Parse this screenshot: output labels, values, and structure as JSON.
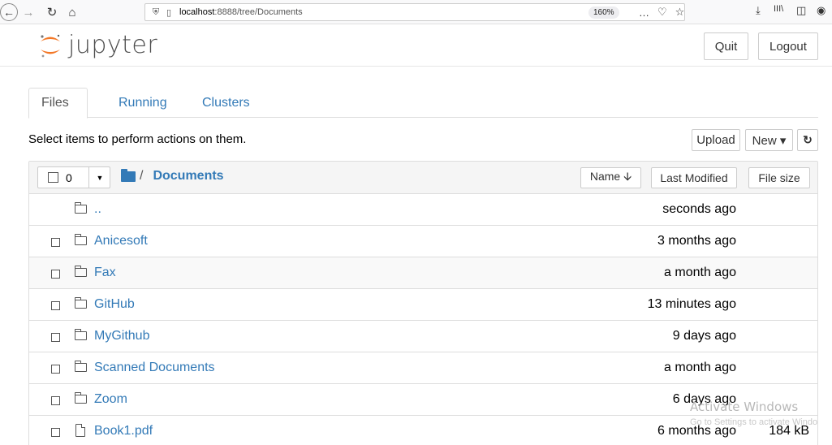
{
  "browser": {
    "back_icon": "←",
    "forward_icon": "→",
    "reload_icon": "↻",
    "home_icon": "⌂",
    "url_prefix": "localhost",
    "url_rest": ":8888/tree/Documents",
    "zoom": "160%",
    "more_icon": "…",
    "pocket_icon": "♡",
    "star_icon": "☆",
    "download_icon": "⤓",
    "library_icon": "III\\",
    "sidebar_icon": "◫",
    "account_icon": "◉"
  },
  "header": {
    "logo_text": "jupyter",
    "quit_label": "Quit",
    "logout_label": "Logout"
  },
  "tabs": [
    {
      "label": "Files"
    },
    {
      "label": "Running"
    },
    {
      "label": "Clusters"
    }
  ],
  "toolbar": {
    "instructions": "Select items to perform actions on them.",
    "upload_label": "Upload",
    "new_label": "New ▾",
    "refresh_icon": "↻"
  },
  "list_header": {
    "selected_count": "0",
    "caret": "▼",
    "breadcrumb_sep": "/",
    "current_dir": "Documents",
    "sort_name": "Name 🡫",
    "sort_modified": "Last Modified",
    "sort_size": "File size"
  },
  "items": [
    {
      "name": "..",
      "modified": "seconds ago",
      "size": "",
      "kind": "up"
    },
    {
      "name": "Anicesoft",
      "modified": "3 months ago",
      "size": "",
      "kind": "folder"
    },
    {
      "name": "Fax",
      "modified": "a month ago",
      "size": "",
      "kind": "folder"
    },
    {
      "name": "GitHub",
      "modified": "13 minutes ago",
      "size": "",
      "kind": "folder"
    },
    {
      "name": "MyGithub",
      "modified": "9 days ago",
      "size": "",
      "kind": "folder"
    },
    {
      "name": "Scanned Documents",
      "modified": "a month ago",
      "size": "",
      "kind": "folder"
    },
    {
      "name": "Zoom",
      "modified": "6 days ago",
      "size": "",
      "kind": "folder"
    },
    {
      "name": "Book1.pdf",
      "modified": "6 months ago",
      "size": "184 kB",
      "kind": "file"
    }
  ],
  "watermark": {
    "title": "Activate Windows",
    "subtitle": "Go to Settings to activate Windo"
  }
}
